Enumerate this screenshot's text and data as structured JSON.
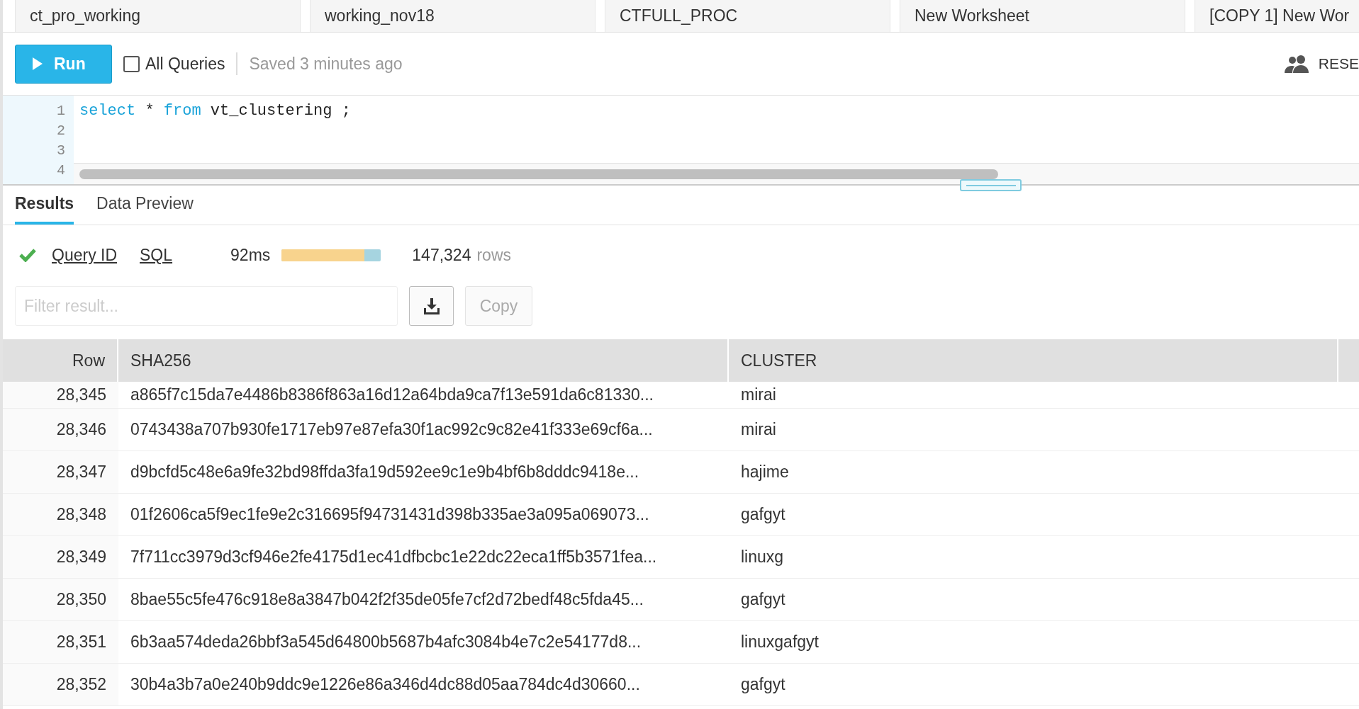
{
  "worksheet_tabs": [
    {
      "label": "ct_pro_working"
    },
    {
      "label": "working_nov18"
    },
    {
      "label": "CTFULL_PROC"
    },
    {
      "label": "New Worksheet"
    },
    {
      "label": "[COPY 1] New Wor"
    }
  ],
  "toolbar": {
    "run_label": "Run",
    "all_queries": {
      "label": "All Queries",
      "checked": false
    },
    "saved_status": "Saved 3 minutes ago",
    "role_label": "RESE"
  },
  "editor": {
    "line_numbers": [
      "1",
      "2",
      "3",
      "4"
    ],
    "lines": [
      [
        {
          "kind": "keyword",
          "text": "select"
        },
        {
          "kind": "plain",
          "text": " * "
        },
        {
          "kind": "keyword",
          "text": "from"
        },
        {
          "kind": "plain",
          "text": " vt_clustering ;"
        }
      ]
    ]
  },
  "result_tabs": [
    {
      "label": "Results",
      "selected": true
    },
    {
      "label": "Data Preview",
      "selected": false
    }
  ],
  "query_status": {
    "success": true,
    "query_id_link": "Query ID",
    "sql_link": "SQL",
    "duration": "92ms",
    "level": 0.83,
    "row_count": "147,324",
    "rows_label": "rows"
  },
  "filter": {
    "placeholder": "Filter result..."
  },
  "copy_label": "Copy",
  "table": {
    "columns": [
      "Row",
      "SHA256",
      "CLUSTER"
    ],
    "rows": [
      [
        "28,345",
        "a865f7c15da7e4486b8386f863a16d12a64bda9ca7f13e591da6c81330...",
        "mirai"
      ],
      [
        "28,346",
        "0743438a707b930fe1717eb97e87efa30f1ac992c9c82e41f333e69cf6a...",
        "mirai"
      ],
      [
        "28,347",
        "d9bcfd5c48e6a9fe32bd98ffda3fa19d592ee9c1e9b4bf6b8dddc9418e...",
        "hajime"
      ],
      [
        "28,348",
        "01f2606ca5f9ec1fe9e2c316695f94731431d398b335ae3a095a069073...",
        "gafgyt"
      ],
      [
        "28,349",
        "7f711cc3979d3cf946e2fe4175d1ec41dfbcbc1e22dc22eca1ff5b3571fea...",
        "linuxg"
      ],
      [
        "28,350",
        "8bae55c5fe476c918e8a3847b042f2f35de05fe7cf2d72bedf48c5fda45...",
        "gafgyt"
      ],
      [
        "28,351",
        "6b3aa574deda26bbf3a545d64800b5687b4afc3084b4e7c2e54177d8...",
        "linuxgafgyt"
      ],
      [
        "28,352",
        "30b4a3b7a0e240b9ddc9e1226e86a346d4dc88d05aa784dc4d30660...",
        "gafgyt"
      ]
    ]
  }
}
